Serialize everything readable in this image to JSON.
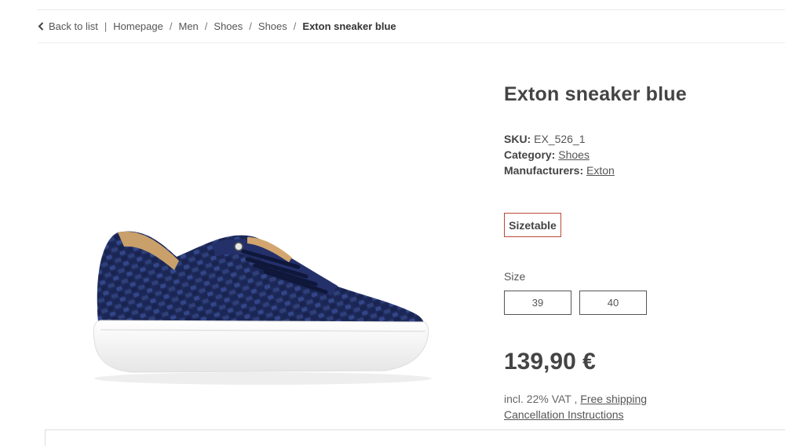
{
  "breadcrumb": {
    "back_label": "Back to list",
    "items": [
      "Homepage",
      "Men",
      "Shoes",
      "Shoes"
    ],
    "current": "Exton sneaker blue",
    "divider": "|",
    "separator": "/"
  },
  "product": {
    "title": "Exton sneaker blue",
    "sku_label": "SKU:",
    "sku_value": "EX_526_1",
    "category_label": "Category:",
    "category_value": "Shoes",
    "manufacturer_label": "Manufacturers:",
    "manufacturer_value": "Exton",
    "sizetable_label": "Sizetable",
    "size_label": "Size",
    "sizes": [
      "39",
      "40"
    ],
    "price": "139,90 €",
    "vat_text": "incl. 22% VAT ,",
    "shipping_link": "Free shipping",
    "cancellation_link": "Cancellation Instructions"
  },
  "colors": {
    "accent_border": "#b84a3a",
    "shoe_navy": "#1e2a5a",
    "sole_white": "#f4f4f4"
  }
}
